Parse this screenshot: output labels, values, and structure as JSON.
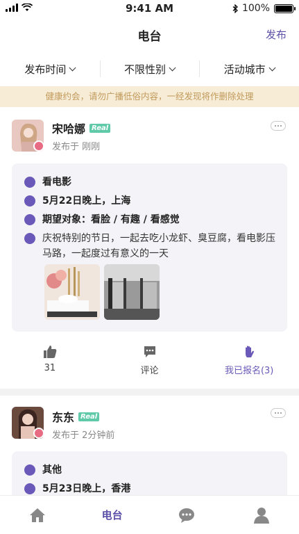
{
  "status": {
    "time": "9:41 AM",
    "battery": "100%"
  },
  "nav": {
    "title": "电台",
    "action": "发布"
  },
  "filters": [
    "发布时间",
    "不限性别",
    "活动城市"
  ],
  "notice": "健康约会，请勿广播低俗内容，一经发现将作删除处理",
  "posts": [
    {
      "name": "宋哈娜",
      "badge": "Real",
      "posted": "发布于 刚刚",
      "activity": "看电影",
      "time_place": "5月22日晚上，上海",
      "expect": "期望对象：看脸 / 有趣 / 看感觉",
      "desc": "庆祝特别的节日，一起去吃小龙虾、臭豆腐，看电影压马路，一起度过有意义的一天",
      "actions": {
        "likes": "31",
        "comment": "评论",
        "joined": "我已报名(3)"
      }
    },
    {
      "name": "东东",
      "badge": "Real",
      "posted": "发布于 2分钟前",
      "activity": "其他",
      "time_place": "5月23日晚上，香港"
    }
  ],
  "tabs": [
    "home-icon",
    "电台",
    "chat-icon",
    "profile-icon"
  ],
  "colors": {
    "accent": "#5b4fa8",
    "notice_bg": "#f7ecd6",
    "real_badge": "#5fc9a8"
  }
}
